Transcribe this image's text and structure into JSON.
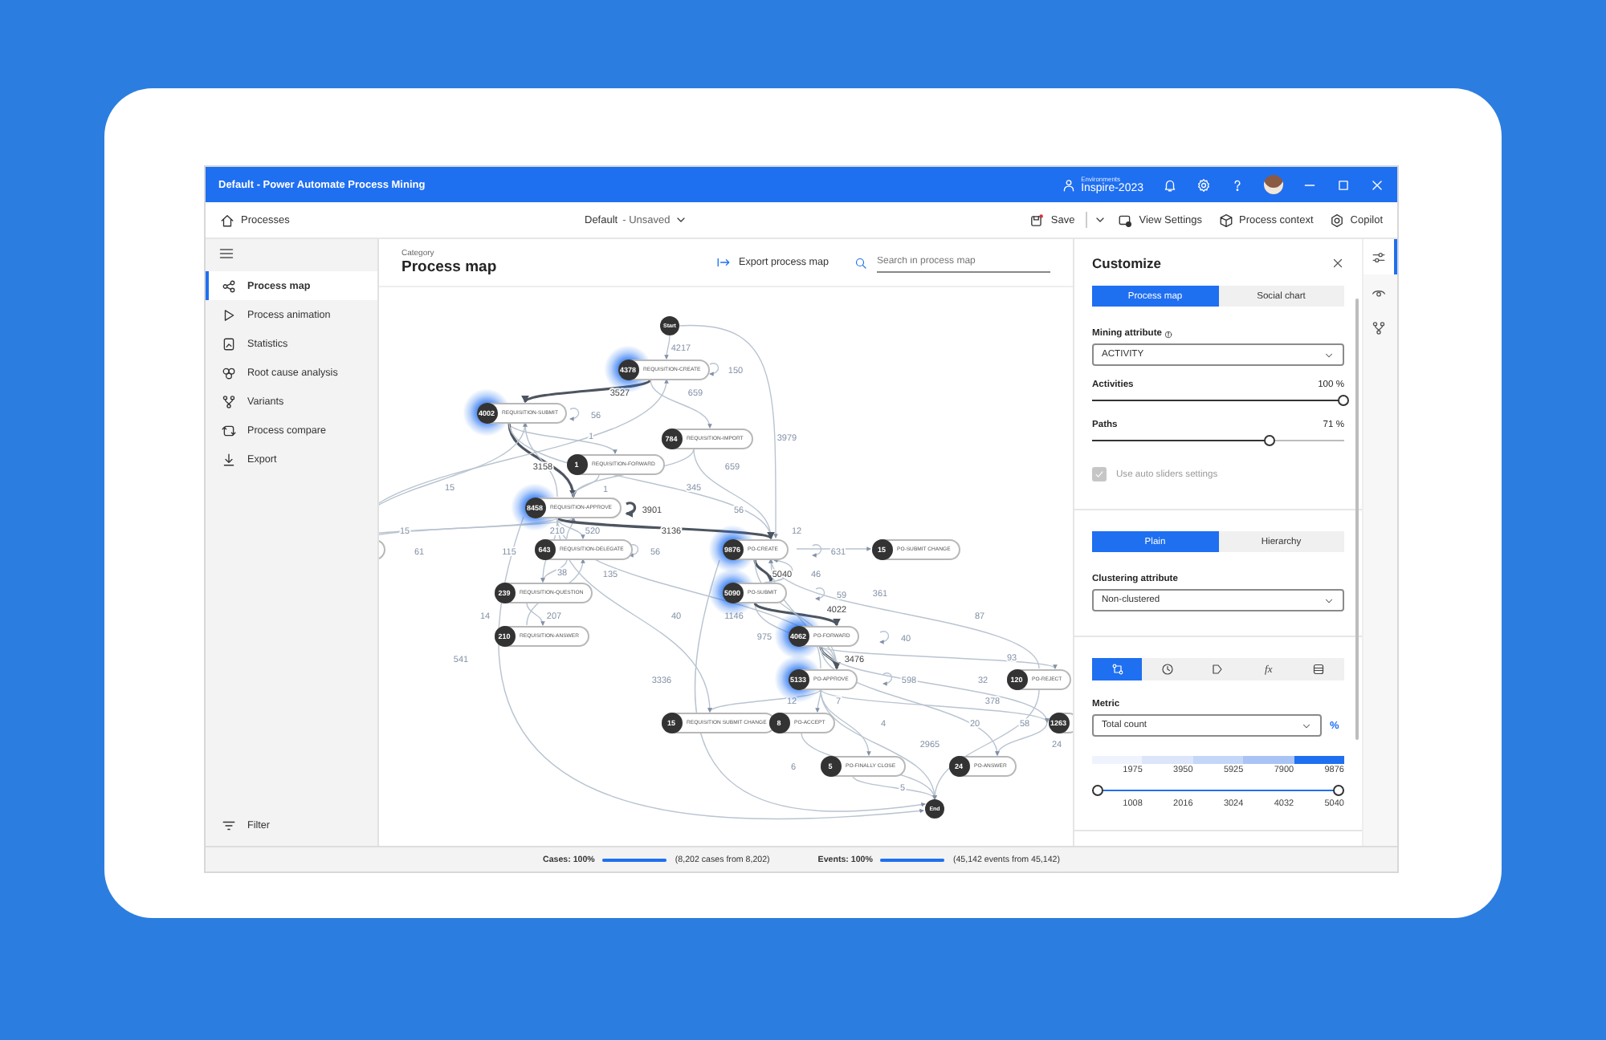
{
  "window": {
    "title": "Default - Power Automate Process Mining",
    "environment_caption": "Environments",
    "environment": "Inspire-2023"
  },
  "toolbar": {
    "home": "Processes",
    "view_name": "Default",
    "view_state": "- Unsaved",
    "save": "Save",
    "view_settings": "View Settings",
    "process_context": "Process context",
    "copilot": "Copilot"
  },
  "sidebar": {
    "items": [
      {
        "label": "Process map",
        "selected": true
      },
      {
        "label": "Process animation",
        "selected": false
      },
      {
        "label": "Statistics",
        "selected": false
      },
      {
        "label": "Root cause analysis",
        "selected": false
      },
      {
        "label": "Variants",
        "selected": false
      },
      {
        "label": "Process compare",
        "selected": false
      },
      {
        "label": "Export",
        "selected": false
      }
    ],
    "filter": "Filter"
  },
  "main": {
    "category": "Category",
    "title": "Process map",
    "export": "Export process map",
    "search": {
      "placeholder": "Search in process map"
    }
  },
  "process_map": {
    "nodes": [
      {
        "kind": "terminal",
        "count": "Start"
      },
      {
        "kind": "activity",
        "count": "4378",
        "label": "REQUISITION-CREATE",
        "glow": true
      },
      {
        "kind": "activity",
        "count": "4002",
        "label": "REQUISITION-SUBMIT",
        "glow": true
      },
      {
        "kind": "activity",
        "count": "784",
        "label": "REQUISITION-IMPORT",
        "glow": false
      },
      {
        "kind": "activity",
        "count": "1",
        "label": "REQUISITION-FORWARD",
        "glow": false
      },
      {
        "kind": "activity",
        "count": "8458",
        "label": "REQUISITION-APPROVE",
        "glow": true
      },
      {
        "kind": "partial"
      },
      {
        "kind": "activity",
        "count": "643",
        "label": "REQUISITION-DELEGATE",
        "glow": false
      },
      {
        "kind": "activity",
        "count": "9876",
        "label": "PO-CREATE",
        "glow": true
      },
      {
        "kind": "activity",
        "count": "15",
        "label": "PO-SUBMIT CHANGE",
        "glow": false
      },
      {
        "kind": "activity",
        "count": "239",
        "label": "REQUISITION-QUESTION",
        "glow": false
      },
      {
        "kind": "activity",
        "count": "5090",
        "label": "PO-SUBMIT",
        "glow": true
      },
      {
        "kind": "activity",
        "count": "210",
        "label": "REQUISITION-ANSWER",
        "glow": false
      },
      {
        "kind": "activity",
        "count": "4062",
        "label": "PO-FORWARD",
        "glow": true
      },
      {
        "kind": "activity",
        "count": "5133",
        "label": "PO-APPROVE",
        "glow": true
      },
      {
        "kind": "activity",
        "count": "120",
        "label": "PO-REJECT",
        "glow": false
      },
      {
        "kind": "activity",
        "count": "15",
        "label": "REQUISITION SUBMIT CHANGE",
        "glow": false
      },
      {
        "kind": "activity",
        "count": "8",
        "label": "PO-ACCEPT",
        "glow": false
      },
      {
        "kind": "activity",
        "count": "1263",
        "glow": false
      },
      {
        "kind": "activity",
        "count": "5",
        "label": "PO-FINALLY CLOSE",
        "glow": false
      },
      {
        "kind": "activity",
        "count": "24",
        "label": "PO-ANSWER",
        "glow": false
      },
      {
        "kind": "terminal",
        "count": "End"
      }
    ],
    "edges": [
      {
        "label": "4217",
        "kind": "minor"
      },
      {
        "label": "150",
        "kind": "minor"
      },
      {
        "label": "3527",
        "kind": "main"
      },
      {
        "label": "659",
        "kind": "minor"
      },
      {
        "label": "56",
        "kind": "minor"
      },
      {
        "label": "1",
        "kind": "minor"
      },
      {
        "label": "3979",
        "kind": "minor"
      },
      {
        "label": "3158",
        "kind": "main"
      },
      {
        "label": "659",
        "kind": "minor"
      },
      {
        "label": "15",
        "kind": "minor"
      },
      {
        "label": "1",
        "kind": "minor"
      },
      {
        "label": "345",
        "kind": "minor"
      },
      {
        "label": "3901",
        "kind": "main"
      },
      {
        "label": "56",
        "kind": "minor"
      },
      {
        "label": "15",
        "kind": "minor"
      },
      {
        "label": "210",
        "kind": "minor"
      },
      {
        "label": "520",
        "kind": "minor"
      },
      {
        "label": "3136",
        "kind": "main"
      },
      {
        "label": "12",
        "kind": "minor"
      },
      {
        "label": "61",
        "kind": "minor"
      },
      {
        "label": "115",
        "kind": "minor"
      },
      {
        "label": "56",
        "kind": "minor"
      },
      {
        "label": "631",
        "kind": "minor"
      },
      {
        "label": "38",
        "kind": "minor"
      },
      {
        "label": "135",
        "kind": "minor"
      },
      {
        "label": "5040",
        "kind": "main"
      },
      {
        "label": "46",
        "kind": "minor"
      },
      {
        "label": "59",
        "kind": "minor"
      },
      {
        "label": "361",
        "kind": "minor"
      },
      {
        "label": "14",
        "kind": "minor"
      },
      {
        "label": "207",
        "kind": "minor"
      },
      {
        "label": "40",
        "kind": "minor"
      },
      {
        "label": "1146",
        "kind": "minor"
      },
      {
        "label": "4022",
        "kind": "main"
      },
      {
        "label": "87",
        "kind": "minor"
      },
      {
        "label": "975",
        "kind": "minor"
      },
      {
        "label": "40",
        "kind": "minor"
      },
      {
        "label": "541",
        "kind": "minor"
      },
      {
        "label": "3476",
        "kind": "main"
      },
      {
        "label": "93",
        "kind": "minor"
      },
      {
        "label": "3336",
        "kind": "minor"
      },
      {
        "label": "598",
        "kind": "minor"
      },
      {
        "label": "32",
        "kind": "minor"
      },
      {
        "label": "12",
        "kind": "minor"
      },
      {
        "label": "7",
        "kind": "minor"
      },
      {
        "label": "378",
        "kind": "minor"
      },
      {
        "label": "4",
        "kind": "minor"
      },
      {
        "label": "20",
        "kind": "minor"
      },
      {
        "label": "58",
        "kind": "minor"
      },
      {
        "label": "2965",
        "kind": "minor"
      },
      {
        "label": "24",
        "kind": "minor"
      },
      {
        "label": "6",
        "kind": "minor"
      },
      {
        "label": "5",
        "kind": "minor"
      },
      {
        "kind": "minor"
      },
      {
        "kind": "minor"
      }
    ]
  },
  "customize": {
    "title": "Customize",
    "view_tabs": [
      {
        "label": "Process map",
        "selected": true
      },
      {
        "label": "Social chart",
        "selected": false
      }
    ],
    "mining_attribute": {
      "label": "Mining attribute",
      "value": "ACTIVITY"
    },
    "sliders": [
      {
        "label": "Activities",
        "reading": "100 %",
        "level": 1
      },
      {
        "label": "Paths",
        "reading": "71 %",
        "level": 0.71
      }
    ],
    "auto_sliders": {
      "label": "Use auto sliders settings",
      "checked": true,
      "disabled": true
    },
    "layout_tabs": [
      {
        "label": "Plain",
        "selected": true
      },
      {
        "label": "Hierarchy",
        "selected": false
      }
    ],
    "clustering_attribute": {
      "label": "Clustering attribute",
      "value": "Non-clustered"
    },
    "metric_tabs": [
      {
        "selected": true
      },
      {
        "selected": false
      },
      {
        "selected": false
      },
      {
        "text": "fx",
        "selected": false
      },
      {
        "selected": false
      }
    ],
    "metric": {
      "label": "Metric",
      "value": "Total count",
      "unit": "%"
    },
    "scale": [
      {
        "label": "1975",
        "color": "#eef3fd"
      },
      {
        "label": "3950",
        "color": "#dbe6fb"
      },
      {
        "label": "5925",
        "color": "#c5d7f8"
      },
      {
        "label": "7900",
        "color": "#a9c3f4"
      },
      {
        "label": "9876",
        "color": "#1f6ff1"
      }
    ],
    "range": {
      "level": 1,
      "ticks": [
        "1008",
        "2016",
        "3024",
        "4032",
        "5040"
      ]
    }
  },
  "rail": [
    {
      "selected": true
    },
    {
      "selected": false
    },
    {
      "selected": false
    }
  ],
  "status_bar": {
    "cases": {
      "label": "Cases: 100%",
      "level": 1,
      "detail": "(8,202 cases from 8,202)"
    },
    "events": {
      "label": "Events: 100%",
      "level": 1,
      "detail": "(45,142 events from 45,142)"
    }
  }
}
